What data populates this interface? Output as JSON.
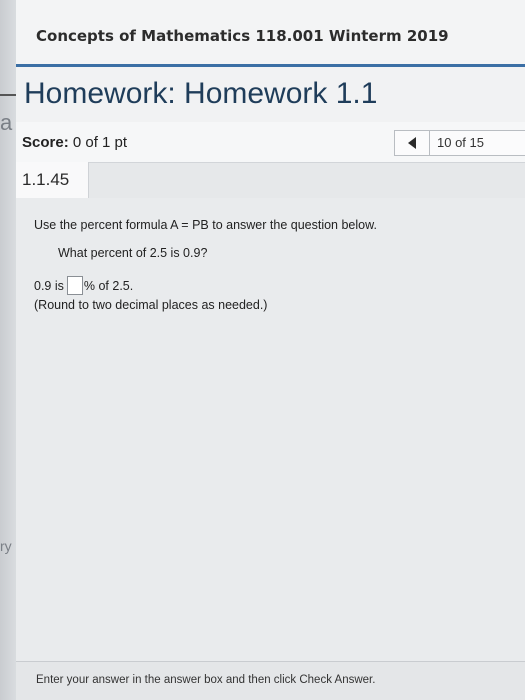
{
  "course": {
    "title": "Concepts of Mathematics 118.001 Winterm 2019"
  },
  "homework": {
    "title": "Homework: Homework 1.1"
  },
  "score": {
    "label": "Score:",
    "value": "0 of 1 pt"
  },
  "navigation": {
    "position": "10 of 15"
  },
  "question": {
    "id": "1.1.45",
    "instruction": "Use the percent formula A = PB to answer the question below.",
    "prompt": "What percent of 2.5 is 0.9?",
    "answer_prefix": "0.9 is",
    "answer_suffix": "% of 2.5.",
    "answer_value": "",
    "rounding_note": "(Round to two decimal places as needed.)"
  },
  "footer": {
    "hint": "Enter your answer in the answer box and then click Check Answer."
  },
  "left_fragments": {
    "top": "a",
    "bottom": "ry"
  },
  "colors": {
    "accent_rule": "#3b6fa5",
    "title_text": "#1f3d5a"
  }
}
